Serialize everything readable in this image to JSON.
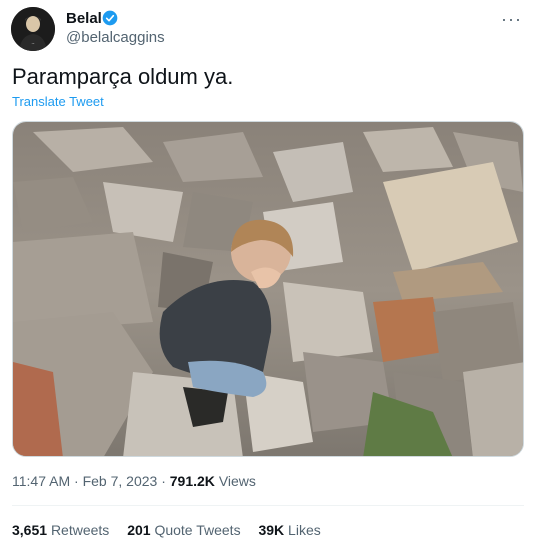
{
  "author": {
    "display_name": "Belal",
    "handle": "@belalcaggins",
    "verified": true,
    "avatar_icon": "avatar-person-icon"
  },
  "tweet": {
    "text": "Paramparça oldum ya.",
    "translate_label": "Translate Tweet",
    "time": "11:47 AM",
    "date": "Feb 7, 2023",
    "separator": "·",
    "views_count": "791.2K",
    "views_label": "Views"
  },
  "stats": {
    "retweets_count": "3,651",
    "retweets_label": "Retweets",
    "quotes_count": "201",
    "quotes_label": "Quote Tweets",
    "likes_count": "39K",
    "likes_label": "Likes"
  },
  "colors": {
    "accent": "#1d9bf0",
    "text": "#0f1419",
    "muted": "#536471"
  }
}
